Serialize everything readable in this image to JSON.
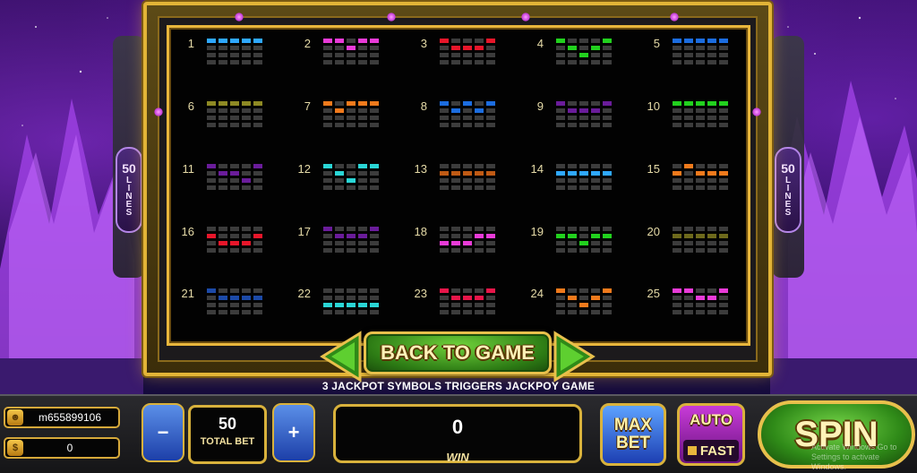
{
  "paylines": [
    {
      "n": "1",
      "color": "#2fa8ff",
      "rows": [
        0,
        0,
        0,
        0,
        0
      ]
    },
    {
      "n": "2",
      "color": "#e93bd8",
      "rows": [
        0,
        0,
        1,
        0,
        0
      ]
    },
    {
      "n": "3",
      "color": "#e8162a",
      "rows": [
        0,
        1,
        1,
        1,
        0
      ]
    },
    {
      "n": "4",
      "color": "#22d11e",
      "rows": [
        0,
        1,
        2,
        1,
        0
      ]
    },
    {
      "n": "5",
      "color": "#1c6de0",
      "rows": [
        0,
        0,
        0,
        0,
        0
      ]
    },
    {
      "n": "6",
      "color": "#8e8a24",
      "rows": [
        0,
        0,
        0,
        0,
        0
      ]
    },
    {
      "n": "7",
      "color": "#f07a1c",
      "rows": [
        0,
        1,
        0,
        0,
        0
      ]
    },
    {
      "n": "8",
      "color": "#1c6de0",
      "rows": [
        0,
        1,
        0,
        1,
        0
      ]
    },
    {
      "n": "9",
      "color": "#6a1c9a",
      "rows": [
        0,
        1,
        1,
        1,
        0
      ]
    },
    {
      "n": "10",
      "color": "#22d11e",
      "rows": [
        0,
        0,
        0,
        0,
        0
      ]
    },
    {
      "n": "11",
      "color": "#6a1c9a",
      "rows": [
        0,
        1,
        1,
        2,
        0
      ]
    },
    {
      "n": "12",
      "color": "#2ad6d6",
      "rows": [
        0,
        1,
        2,
        0,
        0
      ]
    },
    {
      "n": "13",
      "color": "#c05a14",
      "rows": [
        1,
        1,
        1,
        1,
        1
      ]
    },
    {
      "n": "14",
      "color": "#2fa8ff",
      "rows": [
        1,
        1,
        1,
        1,
        1
      ]
    },
    {
      "n": "15",
      "color": "#f07a1c",
      "rows": [
        1,
        0,
        1,
        1,
        1
      ]
    },
    {
      "n": "16",
      "color": "#e8162a",
      "rows": [
        1,
        2,
        2,
        2,
        1
      ]
    },
    {
      "n": "17",
      "color": "#6a1c9a",
      "rows": [
        0,
        1,
        1,
        1,
        0
      ]
    },
    {
      "n": "18",
      "color": "#e93bd8",
      "rows": [
        2,
        2,
        2,
        1,
        1
      ]
    },
    {
      "n": "19",
      "color": "#22d11e",
      "rows": [
        1,
        1,
        2,
        1,
        1
      ]
    },
    {
      "n": "20",
      "color": "#6e6a1c",
      "rows": [
        1,
        1,
        1,
        1,
        1
      ]
    },
    {
      "n": "21",
      "color": "#1c4aa8",
      "rows": [
        0,
        1,
        1,
        1,
        1
      ]
    },
    {
      "n": "22",
      "color": "#2ad6d6",
      "rows": [
        2,
        2,
        2,
        2,
        2
      ]
    },
    {
      "n": "23",
      "color": "#e8164a",
      "rows": [
        0,
        1,
        1,
        1,
        0
      ]
    },
    {
      "n": "24",
      "color": "#f07a1c",
      "rows": [
        0,
        1,
        2,
        1,
        0
      ]
    },
    {
      "n": "25",
      "color": "#e93bd8",
      "rows": [
        0,
        0,
        1,
        1,
        0
      ]
    }
  ],
  "side_badge": {
    "num": "50",
    "word": "LINES"
  },
  "back_button": "BACK TO GAME",
  "jackpot_text": "3 JACKPOT SYMBOLS TRIGGERS JACKPOY GAME",
  "account": {
    "username": "m655899106",
    "balance": "0",
    "user_icon": "user-icon",
    "coin_icon": "coin-icon"
  },
  "bet": {
    "value": "50",
    "label": "TOTAL BET",
    "minus": "−",
    "plus": "+"
  },
  "win": {
    "value": "0",
    "label": "WIN"
  },
  "max_bet": {
    "line1": "MAX",
    "line2": "BET"
  },
  "auto": {
    "label": "AUTO",
    "fast_label": "FAST"
  },
  "spin": "SPIN",
  "watermark": "Activate Windows Go to Settings to activate Windows.",
  "colors": {
    "gold": "#e2b437",
    "panel": "#020202",
    "inactive_cell": "#3c3c3c",
    "label": "#e6dba8"
  }
}
